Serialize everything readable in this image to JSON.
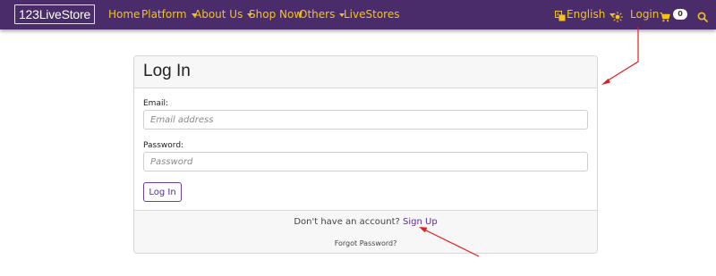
{
  "navbar": {
    "brand": "123LiveStore",
    "items": [
      {
        "label": "Home",
        "dropdown": false
      },
      {
        "label": "Platform",
        "dropdown": true
      },
      {
        "label": "About Us",
        "dropdown": true
      },
      {
        "label": "Shop Now",
        "dropdown": false
      },
      {
        "label": "Others",
        "dropdown": true
      },
      {
        "label": "LiveStores",
        "dropdown": false
      }
    ],
    "language": {
      "icon": "translate-icon",
      "label": "English"
    },
    "theme_icon": "sun-icon",
    "login_label": "Login",
    "cart": {
      "icon": "cart-icon",
      "count": "0"
    },
    "search_icon": "search-icon",
    "colors": {
      "background": "#4a2c6b",
      "link": "#f3c316"
    }
  },
  "card": {
    "title": "Log In",
    "email": {
      "label": "Email:",
      "placeholder": "Email address",
      "value": ""
    },
    "password": {
      "label": "Password:",
      "placeholder": "Password",
      "value": ""
    },
    "submit_label": "Log In",
    "footer": {
      "signup_prompt": "Don't have an account?",
      "signup_link": "Sign Up",
      "forgot_password": "Forgot Password?"
    },
    "accent_color": "#5a2d91"
  },
  "annotations": {
    "arrow_color": "#e02020"
  }
}
